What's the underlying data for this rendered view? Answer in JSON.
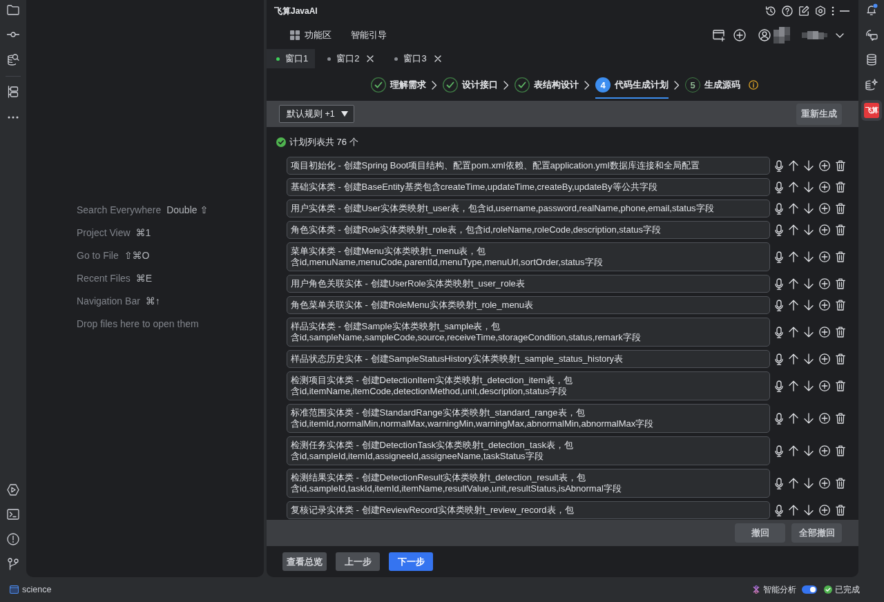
{
  "editor_panel": {
    "hints": [
      {
        "action": "Search Everywhere",
        "shortcut": "Double ⇧"
      },
      {
        "action": "Project View",
        "shortcut": "⌘1"
      },
      {
        "action": "Go to File",
        "shortcut": "⇧⌘O"
      },
      {
        "action": "Recent Files",
        "shortcut": "⌘E"
      },
      {
        "action": "Navigation Bar",
        "shortcut": "⌘↑"
      },
      {
        "action": "Drop files here to open them"
      }
    ]
  },
  "plugin": {
    "title": "飞算JavaAI",
    "nav": {
      "function_area": "功能区",
      "guide": "智能引导"
    },
    "window_tabs": [
      {
        "label": "窗口1",
        "selected": true,
        "closable": false
      },
      {
        "label": "窗口2",
        "selected": false,
        "closable": true
      },
      {
        "label": "窗口3",
        "selected": false,
        "closable": true
      }
    ],
    "steps": [
      {
        "label": "理解需求",
        "done": true,
        "current": false
      },
      {
        "label": "设计接口",
        "done": true,
        "current": false
      },
      {
        "label": "表结构设计",
        "done": true,
        "current": false
      },
      {
        "number": "4",
        "label": "代码生成计划",
        "done": false,
        "current": true
      },
      {
        "number": "5",
        "label": "生成源码",
        "done": false,
        "current": false
      }
    ],
    "rules_dropdown": {
      "value": "默认规则 +1"
    },
    "regenerate_button": "重新生成",
    "summary": "计划列表共 76 个",
    "plan_items": [
      {
        "lines": [
          "项目初始化 - 创建Spring Boot项目结构、配置pom.xml依赖、配置application.yml数据库连接和全局配置"
        ]
      },
      {
        "lines": [
          "基础实体类 - 创建BaseEntity基类包含createTime,updateTime,createBy,updateBy等公共字段"
        ]
      },
      {
        "lines": [
          "用户实体类 - 创建User实体类映射t_user表，包含id,username,password,realName,phone,email,status字段"
        ]
      },
      {
        "lines": [
          "角色实体类 - 创建Role实体类映射t_role表，包含id,roleName,roleCode,description,status字段"
        ]
      },
      {
        "lines": [
          "菜单实体类 - 创建Menu实体类映射t_menu表，包",
          "含id,menuName,menuCode,parentId,menuType,menuUrl,sortOrder,status字段"
        ]
      },
      {
        "lines": [
          "用户角色关联实体 - 创建UserRole实体类映射t_user_role表"
        ]
      },
      {
        "lines": [
          "角色菜单关联实体 - 创建RoleMenu实体类映射t_role_menu表"
        ]
      },
      {
        "lines": [
          "样品实体类 - 创建Sample实体类映射t_sample表，包",
          "含id,sampleName,sampleCode,source,receiveTime,storageCondition,status,remark字段"
        ]
      },
      {
        "lines": [
          "样品状态历史实体 - 创建SampleStatusHistory实体类映射t_sample_status_history表"
        ]
      },
      {
        "lines": [
          "检测项目实体类 - 创建DetectionItem实体类映射t_detection_item表，包",
          "含id,itemName,itemCode,detectionMethod,unit,description,status字段"
        ]
      },
      {
        "lines": [
          "标准范围实体类 - 创建StandardRange实体类映射t_standard_range表，包",
          "含id,itemId,normalMin,normalMax,warningMin,warningMax,abnormalMin,abnormalMax字段"
        ]
      },
      {
        "lines": [
          "检测任务实体类 - 创建DetectionTask实体类映射t_detection_task表，包",
          "含id,sampleId,itemId,assigneeId,assigneeName,taskStatus字段"
        ]
      },
      {
        "lines": [
          "检测结果实体类 - 创建DetectionResult实体类映射t_detection_result表，包",
          "含id,sampleId,taskId,itemId,itemName,resultValue,unit,resultStatus,isAbnormal字段"
        ]
      },
      {
        "lines": [
          "复核记录实体类 - 创建ReviewRecord实体类映射t_review_record表，包"
        ]
      }
    ],
    "revert_buttons": [
      "撤回",
      "全部撤回"
    ],
    "footer_buttons": [
      {
        "label": "查看总览",
        "primary": false
      },
      {
        "label": "上一步",
        "primary": false
      },
      {
        "label": "下一步",
        "primary": true
      }
    ]
  },
  "right_toolbar": {
    "notifications_unread": true,
    "plugin_logo": {
      "text": "飞算",
      "selected": true
    }
  },
  "status_bar": {
    "project": "science",
    "analysis_label": "智能分析",
    "analysis_on": true,
    "status": "已完成"
  }
}
